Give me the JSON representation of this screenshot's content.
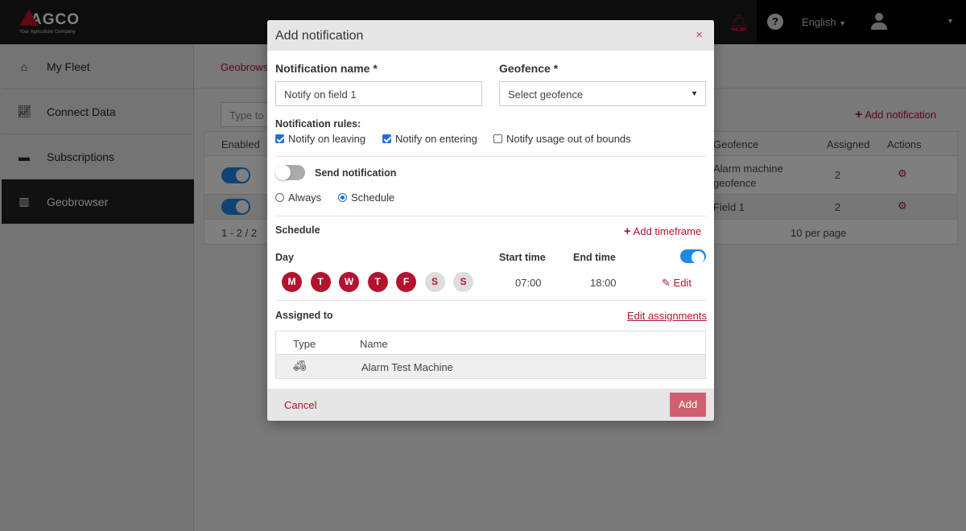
{
  "header": {
    "logo_name": "AGCO",
    "logo_tagline": "Your Agriculture Company",
    "language": "English"
  },
  "sidebar": {
    "items": [
      {
        "label": "My Fleet",
        "icon": "home-icon"
      },
      {
        "label": "Connect Data",
        "icon": "chart-icon"
      },
      {
        "label": "Subscriptions",
        "icon": "card-icon"
      },
      {
        "label": "Geobrowser",
        "icon": "fence-icon",
        "active": true
      }
    ]
  },
  "main": {
    "breadcrumb": "Geobrowser",
    "search_placeholder": "Type to search",
    "add_notification": "Add notification",
    "table": {
      "headers": [
        "Enabled",
        "Geofence",
        "Assigned",
        "Actions"
      ],
      "rows": [
        {
          "enabled": true,
          "geofence": "Alarm machine geofence",
          "assigned": "2"
        },
        {
          "enabled": true,
          "geofence": "Field 1",
          "assigned": "2"
        }
      ],
      "range": "1 - 2 / 2",
      "per_page": "10 per page"
    }
  },
  "modal": {
    "title": "Add notification",
    "close": "×",
    "name_label": "Notification name *",
    "name_value": "Notify on field 1",
    "geofence_label": "Geofence *",
    "geofence_placeholder": "Select geofence",
    "rules_label": "Notification rules:",
    "rules": [
      {
        "label": "Notify on leaving",
        "checked": true
      },
      {
        "label": "Notify on entering",
        "checked": true
      },
      {
        "label": "Notify usage out of bounds",
        "checked": false
      }
    ],
    "send_label": "Send notification",
    "send_on": false,
    "mode_always": "Always",
    "mode_schedule": "Schedule",
    "mode_selected": "Schedule",
    "schedule_label": "Schedule",
    "add_timeframe": "Add timeframe",
    "day_label": "Day",
    "start_label": "Start time",
    "end_label": "End time",
    "days": [
      {
        "l": "M",
        "on": true
      },
      {
        "l": "T",
        "on": true
      },
      {
        "l": "W",
        "on": true
      },
      {
        "l": "T",
        "on": true
      },
      {
        "l": "F",
        "on": true
      },
      {
        "l": "S",
        "on": false
      },
      {
        "l": "S",
        "on": false
      }
    ],
    "start": "07:00",
    "end": "18:00",
    "edit": "Edit",
    "timeframe_enabled": true,
    "assigned_label": "Assigned to",
    "edit_assignments": "Edit assignments",
    "assign_headers": [
      "Type",
      "Name"
    ],
    "assign_rows": [
      {
        "type_icon": "tractor-icon",
        "name": "Alarm Test Machine"
      }
    ],
    "cancel": "Cancel",
    "add": "Add"
  },
  "colors": {
    "brand": "#b3132f",
    "toggle": "#1e88e5"
  }
}
